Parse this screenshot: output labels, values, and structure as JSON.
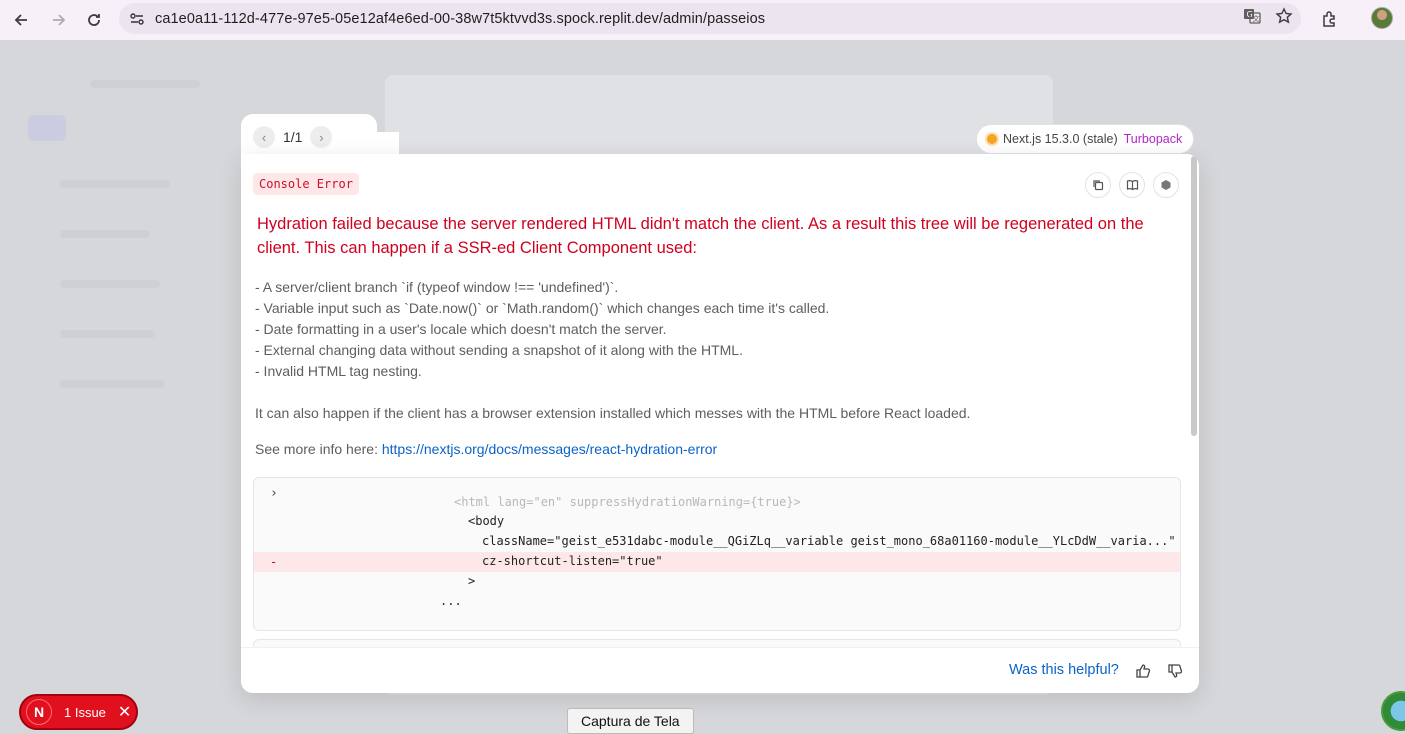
{
  "browser": {
    "url": "ca1e0a11-112d-477e-97e5-05e12af4e6ed-00-38w7t5ktvvd3s.spock.replit.dev/admin/passeios",
    "icons": [
      "back-icon",
      "forward-icon",
      "reload-icon",
      "site-settings-icon",
      "translate-icon",
      "star-icon",
      "extensions-icon",
      "profile-avatar"
    ]
  },
  "overlay": {
    "pager": {
      "count": "1/1"
    },
    "version": {
      "label": "Next.js 15.3.0 (stale)",
      "bundler": "Turbopack"
    },
    "badge": "Console Error",
    "title": "Hydration failed because the server rendered HTML didn't match the client. As a result this tree will be regenerated on the client. This can happen if a SSR-ed Client Component used:",
    "bullets": [
      "- A server/client branch `if (typeof window !== 'undefined')`.",
      "- Variable input such as `Date.now()` or `Math.random()` which changes each time it's called.",
      "- Date formatting in a user's locale which doesn't match the server.",
      "- External changing data without sending a snapshot of it along with the HTML.",
      "- Invalid HTML tag nesting."
    ],
    "extension_note": "It can also happen if the client has a browser extension installed which messes with the HTML before React loaded.",
    "more_info_prefix": "See more info here:",
    "more_info_link": "https://nextjs.org/docs/messages/react-hydration-error",
    "code": {
      "faded_line": "<html lang=\"en\" suppressHydrationWarning={true}>",
      "body_open": "<body",
      "classname_line": "className=\"geist_e531dabc-module__QGiZLq__variable geist_mono_68a01160-module__YLcDdW__varia...\"",
      "diff_marker": "-",
      "diff_line": "cz-shortcut-listen=\"true\"",
      "close_bracket": ">",
      "ellipsis": "..."
    },
    "helpful": "Was this helpful?"
  },
  "issues": {
    "label": "1 Issue",
    "logo_letter": "N"
  },
  "tooltip": "Captura de Tela",
  "colors": {
    "error_red": "#d1001f",
    "link_blue": "#0b63c8",
    "turbopack": "#b127c3",
    "issue_pill": "#e0101e"
  }
}
